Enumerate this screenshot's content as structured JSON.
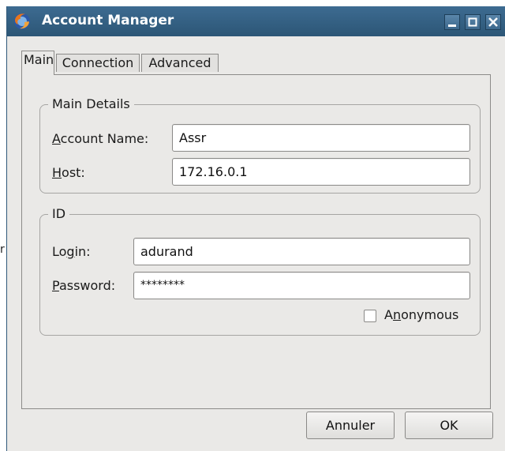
{
  "window": {
    "title": "Account Manager"
  },
  "stray_text": "r",
  "tabs": [
    {
      "label": "Main",
      "active": true
    },
    {
      "label": "Connection",
      "active": false
    },
    {
      "label": "Advanced",
      "active": false
    }
  ],
  "main_details": {
    "title": "Main Details",
    "account_name_label": {
      "mnemonic": "A",
      "rest": "ccount Name:"
    },
    "account_name_value": "Assr",
    "host_label": {
      "mnemonic": "H",
      "rest": "ost:"
    },
    "host_value": "172.16.0.1"
  },
  "id_group": {
    "title": "ID",
    "login_label": {
      "pre": "Lo",
      "mnemonic": "g",
      "rest": "in:"
    },
    "login_value": "adurand",
    "password_label": {
      "mnemonic": "P",
      "rest": "assword:"
    },
    "password_value": "********",
    "anonymous_label": {
      "pre": "A",
      "mnemonic": "n",
      "rest": "onymous"
    },
    "anonymous_checked": false
  },
  "buttons": {
    "cancel": "Annuler",
    "ok": "OK"
  },
  "colors": {
    "titlebar": "#2f5b7e",
    "dialog_bg": "#eae9e7",
    "field_bg": "#ffffff"
  },
  "icons": [
    "firefox-icon",
    "minimize-icon",
    "maximize-icon",
    "close-icon"
  ]
}
